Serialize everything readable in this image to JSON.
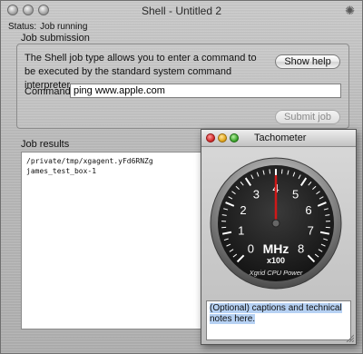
{
  "window": {
    "title": "Shell - Untitled 2"
  },
  "status": {
    "label": "Status:",
    "value": "Job running"
  },
  "submission": {
    "heading": "Job submission",
    "description": "The Shell job type allows you to enter a command to be executed by the standard system command interpreter.",
    "show_help_label": "Show help",
    "command_label": "Command:",
    "command_value": "ping www.apple.com",
    "submit_label": "Submit job"
  },
  "results": {
    "heading": "Job results",
    "lines": [
      "/private/tmp/xgagent.yFd6RNZg",
      "james_test_box-1"
    ]
  },
  "tachometer": {
    "title": "Tachometer",
    "unit": "MHz",
    "multiplier": "x100",
    "caption": "Xgrid CPU Power",
    "ticks": [
      "0",
      "1",
      "2",
      "3",
      "4",
      "5",
      "6",
      "7",
      "8"
    ],
    "needle_value": 4,
    "notes": "(Optional) captions and technical notes here."
  }
}
